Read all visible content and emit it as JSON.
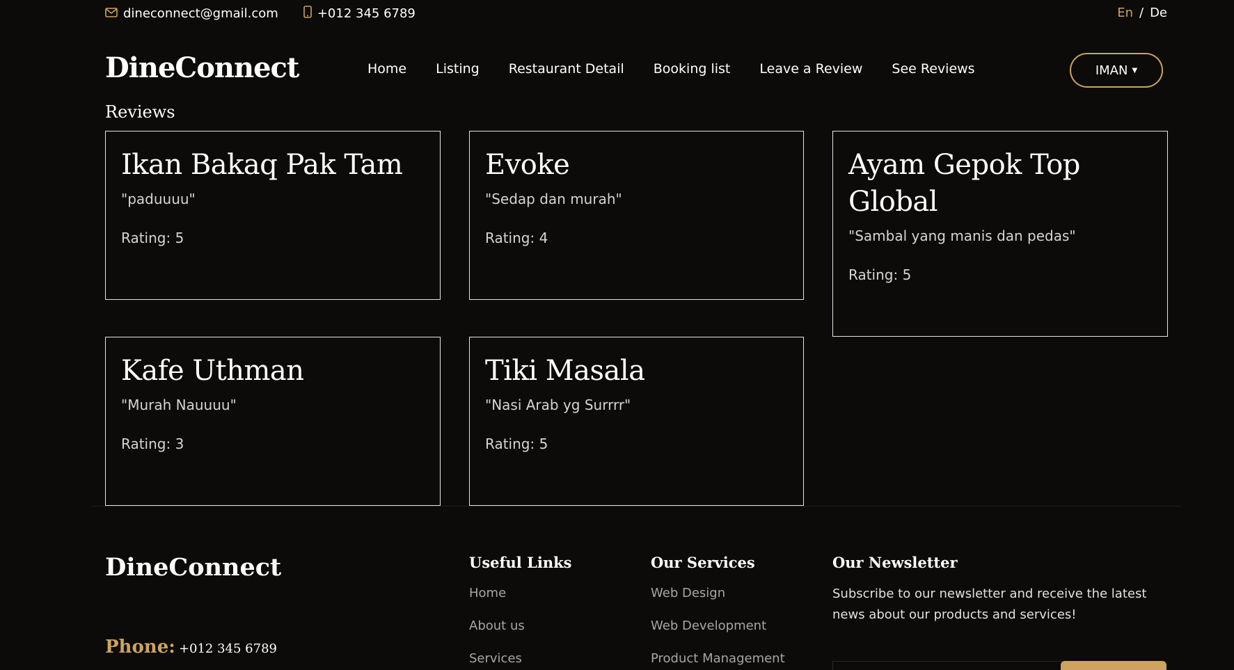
{
  "topbar": {
    "email": "dineconnect@gmail.com",
    "phone": "+012 345 6789",
    "lang_en": "En",
    "lang_sep": "/",
    "lang_de": "De"
  },
  "header": {
    "brand": "DineConnect",
    "nav": [
      "Home",
      "Listing",
      "Restaurant Detail",
      "Booking list",
      "Leave a Review",
      "See Reviews"
    ],
    "user": "IMAN"
  },
  "reviews": {
    "title": "Reviews",
    "items": [
      {
        "name": "Ikan Bakaq Pak Tam",
        "quote": "\"paduuuu\"",
        "rating": "Rating: 5"
      },
      {
        "name": "Evoke",
        "quote": "\"Sedap dan murah\"",
        "rating": "Rating: 4"
      },
      {
        "name": "Ayam Gepok Top Global",
        "quote": "\"Sambal yang manis dan pedas\"",
        "rating": "Rating: 5"
      },
      {
        "name": "Kafe Uthman",
        "quote": "\"Murah Nauuuu\"",
        "rating": "Rating: 3"
      },
      {
        "name": "Tiki Masala",
        "quote": "\"Nasi Arab yg Surrrr\"",
        "rating": "Rating: 5"
      }
    ]
  },
  "footer": {
    "brand": "DineConnect",
    "phone_label": "Phone:",
    "phone_value": "+012 345 6789",
    "useful_links": {
      "title": "Useful Links",
      "items": [
        "Home",
        "About us",
        "Services"
      ]
    },
    "services": {
      "title": "Our Services",
      "items": [
        "Web Design",
        "Web Development",
        "Product Management"
      ]
    },
    "newsletter": {
      "title": "Our Newsletter",
      "text": "Subscribe to our newsletter and receive the latest news about our products and services!"
    }
  },
  "colors": {
    "background": "#0c0b09",
    "accent": "#cda45e",
    "text": "#ffffff",
    "muted": "#a6a6a6"
  }
}
